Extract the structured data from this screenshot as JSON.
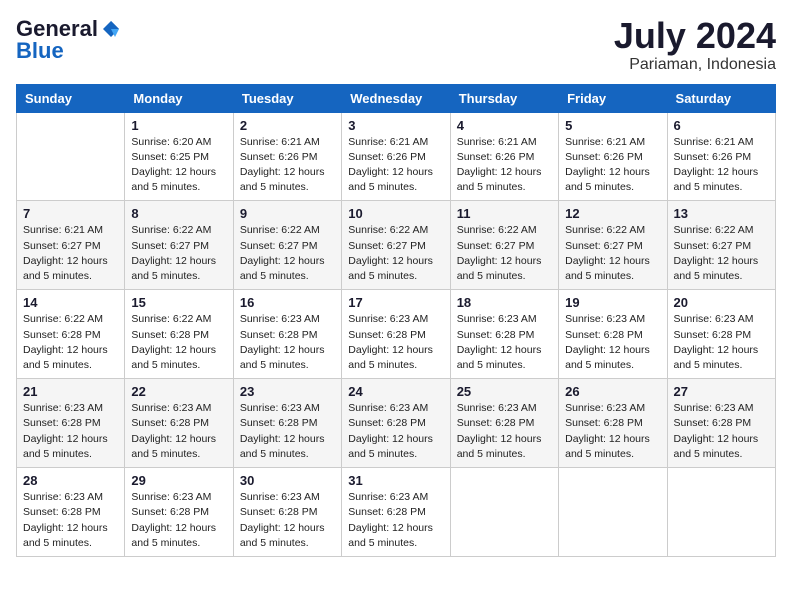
{
  "logo": {
    "general": "General",
    "blue": "Blue"
  },
  "title": "July 2024",
  "location": "Pariaman, Indonesia",
  "days_header": [
    "Sunday",
    "Monday",
    "Tuesday",
    "Wednesday",
    "Thursday",
    "Friday",
    "Saturday"
  ],
  "weeks": [
    [
      {
        "num": "",
        "info": ""
      },
      {
        "num": "1",
        "info": "Sunrise: 6:20 AM\nSunset: 6:25 PM\nDaylight: 12 hours\nand 5 minutes."
      },
      {
        "num": "2",
        "info": "Sunrise: 6:21 AM\nSunset: 6:26 PM\nDaylight: 12 hours\nand 5 minutes."
      },
      {
        "num": "3",
        "info": "Sunrise: 6:21 AM\nSunset: 6:26 PM\nDaylight: 12 hours\nand 5 minutes."
      },
      {
        "num": "4",
        "info": "Sunrise: 6:21 AM\nSunset: 6:26 PM\nDaylight: 12 hours\nand 5 minutes."
      },
      {
        "num": "5",
        "info": "Sunrise: 6:21 AM\nSunset: 6:26 PM\nDaylight: 12 hours\nand 5 minutes."
      },
      {
        "num": "6",
        "info": "Sunrise: 6:21 AM\nSunset: 6:26 PM\nDaylight: 12 hours\nand 5 minutes."
      }
    ],
    [
      {
        "num": "7",
        "info": "Sunrise: 6:21 AM\nSunset: 6:27 PM\nDaylight: 12 hours\nand 5 minutes."
      },
      {
        "num": "8",
        "info": "Sunrise: 6:22 AM\nSunset: 6:27 PM\nDaylight: 12 hours\nand 5 minutes."
      },
      {
        "num": "9",
        "info": "Sunrise: 6:22 AM\nSunset: 6:27 PM\nDaylight: 12 hours\nand 5 minutes."
      },
      {
        "num": "10",
        "info": "Sunrise: 6:22 AM\nSunset: 6:27 PM\nDaylight: 12 hours\nand 5 minutes."
      },
      {
        "num": "11",
        "info": "Sunrise: 6:22 AM\nSunset: 6:27 PM\nDaylight: 12 hours\nand 5 minutes."
      },
      {
        "num": "12",
        "info": "Sunrise: 6:22 AM\nSunset: 6:27 PM\nDaylight: 12 hours\nand 5 minutes."
      },
      {
        "num": "13",
        "info": "Sunrise: 6:22 AM\nSunset: 6:27 PM\nDaylight: 12 hours\nand 5 minutes."
      }
    ],
    [
      {
        "num": "14",
        "info": "Sunrise: 6:22 AM\nSunset: 6:28 PM\nDaylight: 12 hours\nand 5 minutes."
      },
      {
        "num": "15",
        "info": "Sunrise: 6:22 AM\nSunset: 6:28 PM\nDaylight: 12 hours\nand 5 minutes."
      },
      {
        "num": "16",
        "info": "Sunrise: 6:23 AM\nSunset: 6:28 PM\nDaylight: 12 hours\nand 5 minutes."
      },
      {
        "num": "17",
        "info": "Sunrise: 6:23 AM\nSunset: 6:28 PM\nDaylight: 12 hours\nand 5 minutes."
      },
      {
        "num": "18",
        "info": "Sunrise: 6:23 AM\nSunset: 6:28 PM\nDaylight: 12 hours\nand 5 minutes."
      },
      {
        "num": "19",
        "info": "Sunrise: 6:23 AM\nSunset: 6:28 PM\nDaylight: 12 hours\nand 5 minutes."
      },
      {
        "num": "20",
        "info": "Sunrise: 6:23 AM\nSunset: 6:28 PM\nDaylight: 12 hours\nand 5 minutes."
      }
    ],
    [
      {
        "num": "21",
        "info": "Sunrise: 6:23 AM\nSunset: 6:28 PM\nDaylight: 12 hours\nand 5 minutes."
      },
      {
        "num": "22",
        "info": "Sunrise: 6:23 AM\nSunset: 6:28 PM\nDaylight: 12 hours\nand 5 minutes."
      },
      {
        "num": "23",
        "info": "Sunrise: 6:23 AM\nSunset: 6:28 PM\nDaylight: 12 hours\nand 5 minutes."
      },
      {
        "num": "24",
        "info": "Sunrise: 6:23 AM\nSunset: 6:28 PM\nDaylight: 12 hours\nand 5 minutes."
      },
      {
        "num": "25",
        "info": "Sunrise: 6:23 AM\nSunset: 6:28 PM\nDaylight: 12 hours\nand 5 minutes."
      },
      {
        "num": "26",
        "info": "Sunrise: 6:23 AM\nSunset: 6:28 PM\nDaylight: 12 hours\nand 5 minutes."
      },
      {
        "num": "27",
        "info": "Sunrise: 6:23 AM\nSunset: 6:28 PM\nDaylight: 12 hours\nand 5 minutes."
      }
    ],
    [
      {
        "num": "28",
        "info": "Sunrise: 6:23 AM\nSunset: 6:28 PM\nDaylight: 12 hours\nand 5 minutes."
      },
      {
        "num": "29",
        "info": "Sunrise: 6:23 AM\nSunset: 6:28 PM\nDaylight: 12 hours\nand 5 minutes."
      },
      {
        "num": "30",
        "info": "Sunrise: 6:23 AM\nSunset: 6:28 PM\nDaylight: 12 hours\nand 5 minutes."
      },
      {
        "num": "31",
        "info": "Sunrise: 6:23 AM\nSunset: 6:28 PM\nDaylight: 12 hours\nand 5 minutes."
      },
      {
        "num": "",
        "info": ""
      },
      {
        "num": "",
        "info": ""
      },
      {
        "num": "",
        "info": ""
      }
    ]
  ]
}
